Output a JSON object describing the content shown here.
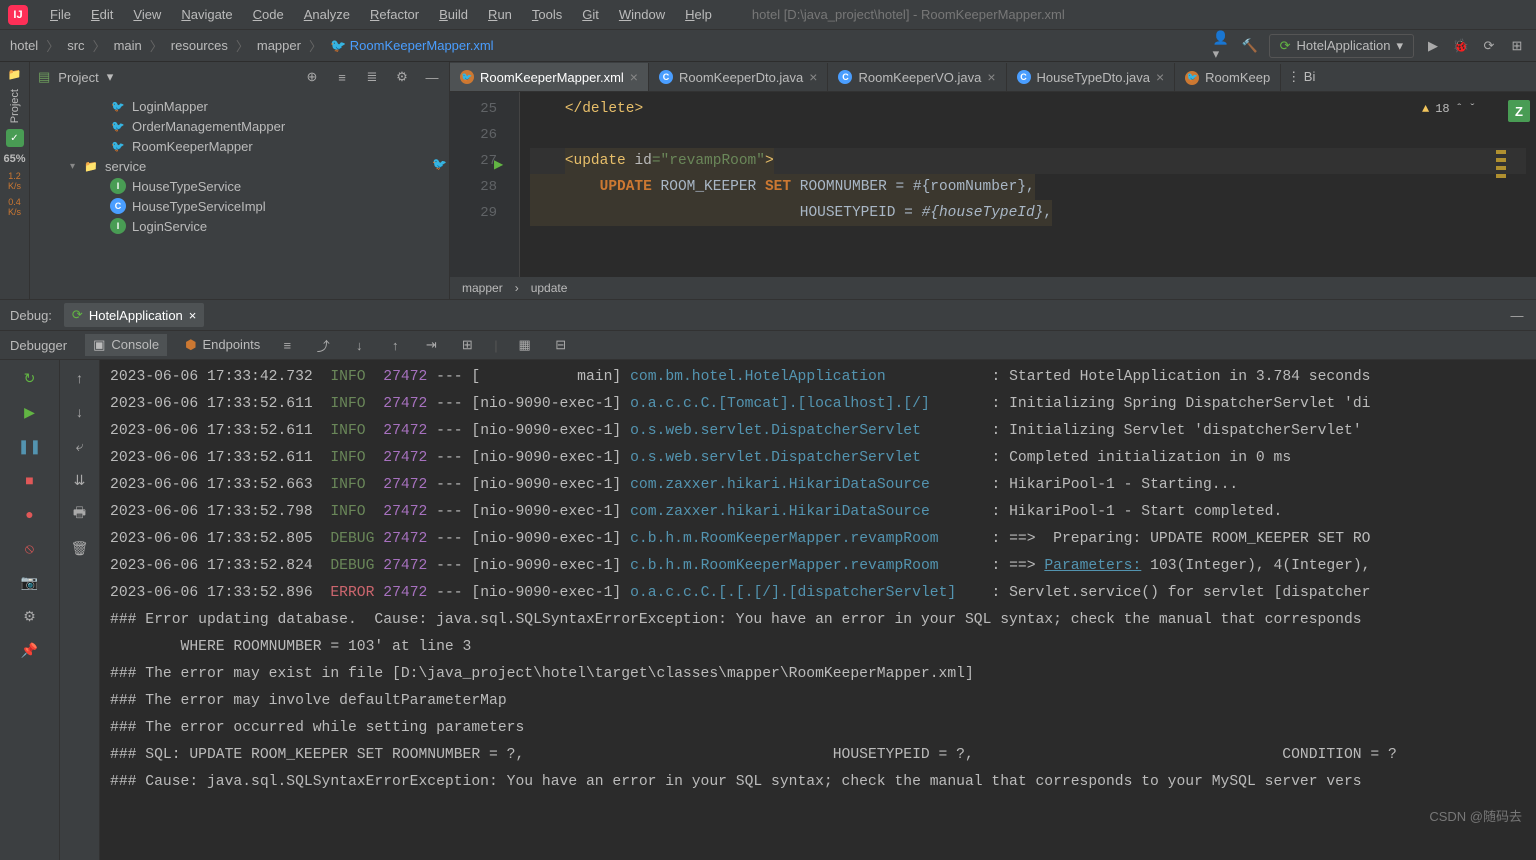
{
  "menu": {
    "items": [
      "File",
      "Edit",
      "View",
      "Navigate",
      "Code",
      "Analyze",
      "Refactor",
      "Build",
      "Run",
      "Tools",
      "Git",
      "Window",
      "Help"
    ],
    "windowTitle": "hotel [D:\\java_project\\hotel] - RoomKeeperMapper.xml"
  },
  "breadcrumb": [
    "hotel",
    "src",
    "main",
    "resources",
    "mapper",
    "RoomKeeperMapper.xml"
  ],
  "runConfig": "HotelApplication",
  "coverage": {
    "pct": "65%",
    "rate1": "1.2\nK/s",
    "rate2": "0.4\nK/s"
  },
  "projectPanel": {
    "title": "Project",
    "items": [
      {
        "name": "LoginMapper",
        "icon": "orange",
        "indent": 2
      },
      {
        "name": "OrderManagementMapper",
        "icon": "orange",
        "indent": 2
      },
      {
        "name": "RoomKeeperMapper",
        "icon": "orange",
        "indent": 2
      },
      {
        "name": "service",
        "icon": "folder",
        "indent": 1,
        "chev": "▾"
      },
      {
        "name": "HouseTypeService",
        "icon": "green",
        "indent": 2,
        "letter": "I"
      },
      {
        "name": "HouseTypeServiceImpl",
        "icon": "blue",
        "indent": 2,
        "letter": "C"
      },
      {
        "name": "LoginService",
        "icon": "green",
        "indent": 2,
        "letter": "I"
      }
    ]
  },
  "editorTabs": [
    {
      "label": "RoomKeeperMapper.xml",
      "type": "xml",
      "active": true,
      "close": true
    },
    {
      "label": "RoomKeeperDto.java",
      "type": "java",
      "close": true
    },
    {
      "label": "RoomKeeperVO.java",
      "type": "java",
      "close": true
    },
    {
      "label": "HouseTypeDto.java",
      "type": "java",
      "close": true
    },
    {
      "label": "RoomKeep",
      "type": "xml",
      "partial": true
    }
  ],
  "editorSideLabel": "Bi",
  "gutterStart": 25,
  "warnCount": "18",
  "code": {
    "l25": {
      "close": "</",
      "tag": "delete",
      "end": ">"
    },
    "l27": {
      "open": "<",
      "tag": "update",
      "attr": "id",
      "eq": "=",
      "val": "\"revampRoom\"",
      "end": ">"
    },
    "l28": {
      "kw1": "UPDATE",
      "tbl": "ROOM_KEEPER",
      "kw2": "SET",
      "col": "ROOMNUMBER = #{roomNumber},"
    },
    "l29": {
      "col": "HOUSETYPEID = ",
      "param": "#{houseTypeId}",
      "comma": ","
    }
  },
  "editorBreadcrumb": [
    "mapper",
    "update"
  ],
  "debug": {
    "label": "Debug:",
    "tab": "HotelApplication",
    "toolbarTabs": [
      "Debugger",
      "Console",
      "Endpoints"
    ]
  },
  "log": [
    {
      "ts": "2023-06-06 17:33:42.732",
      "lvl": "INFO",
      "pid": "27472",
      "thread": "[           main]",
      "cls": "com.bm.hotel.HotelApplication",
      "msg": ": Started HotelApplication in 3.784 seconds"
    },
    {
      "ts": "2023-06-06 17:33:52.611",
      "lvl": "INFO",
      "pid": "27472",
      "thread": "[nio-9090-exec-1]",
      "cls": "o.a.c.c.C.[Tomcat].[localhost].[/]",
      "msg": ": Initializing Spring DispatcherServlet 'di"
    },
    {
      "ts": "2023-06-06 17:33:52.611",
      "lvl": "INFO",
      "pid": "27472",
      "thread": "[nio-9090-exec-1]",
      "cls": "o.s.web.servlet.DispatcherServlet",
      "msg": ": Initializing Servlet 'dispatcherServlet'"
    },
    {
      "ts": "2023-06-06 17:33:52.611",
      "lvl": "INFO",
      "pid": "27472",
      "thread": "[nio-9090-exec-1]",
      "cls": "o.s.web.servlet.DispatcherServlet",
      "msg": ": Completed initialization in 0 ms"
    },
    {
      "ts": "2023-06-06 17:33:52.663",
      "lvl": "INFO",
      "pid": "27472",
      "thread": "[nio-9090-exec-1]",
      "cls": "com.zaxxer.hikari.HikariDataSource",
      "msg": ": HikariPool-1 - Starting..."
    },
    {
      "ts": "2023-06-06 17:33:52.798",
      "lvl": "INFO",
      "pid": "27472",
      "thread": "[nio-9090-exec-1]",
      "cls": "com.zaxxer.hikari.HikariDataSource",
      "msg": ": HikariPool-1 - Start completed."
    },
    {
      "ts": "2023-06-06 17:33:52.805",
      "lvl": "DEBUG",
      "pid": "27472",
      "thread": "[nio-9090-exec-1]",
      "cls": "c.b.h.m.RoomKeeperMapper.revampRoom",
      "msg": ": ==>  Preparing: UPDATE ROOM_KEEPER SET RO"
    },
    {
      "ts": "2023-06-06 17:33:52.824",
      "lvl": "DEBUG",
      "pid": "27472",
      "thread": "[nio-9090-exec-1]",
      "cls": "c.b.h.m.RoomKeeperMapper.revampRoom",
      "msg": ": ==> ",
      "paramLabel": "Parameters:",
      "rest": " 103(Integer), 4(Integer),"
    },
    {
      "ts": "2023-06-06 17:33:52.896",
      "lvl": "ERROR",
      "pid": "27472",
      "thread": "[nio-9090-exec-1]",
      "cls": "o.a.c.c.C.[.[.[/].[dispatcherServlet]",
      "msg": ": Servlet.service() for servlet [dispatcher"
    }
  ],
  "errorLines": [
    "### Error updating database.  Cause: java.sql.SQLSyntaxErrorException: You have an error in your SQL syntax; check the manual that corresponds",
    "",
    "        WHERE ROOMNUMBER = 103' at line 3",
    "### The error may exist in file [D:\\java_project\\hotel\\target\\classes\\mapper\\RoomKeeperMapper.xml]",
    "### The error may involve defaultParameterMap",
    "### The error occurred while setting parameters",
    "### SQL: UPDATE ROOM_KEEPER SET ROOMNUMBER = ?,                                   HOUSETYPEID = ?,                                   CONDITION = ?",
    "### Cause: java.sql.SQLSyntaxErrorException: You have an error in your SQL syntax; check the manual that corresponds to your MySQL server vers"
  ],
  "watermark": "CSDN @随码去"
}
